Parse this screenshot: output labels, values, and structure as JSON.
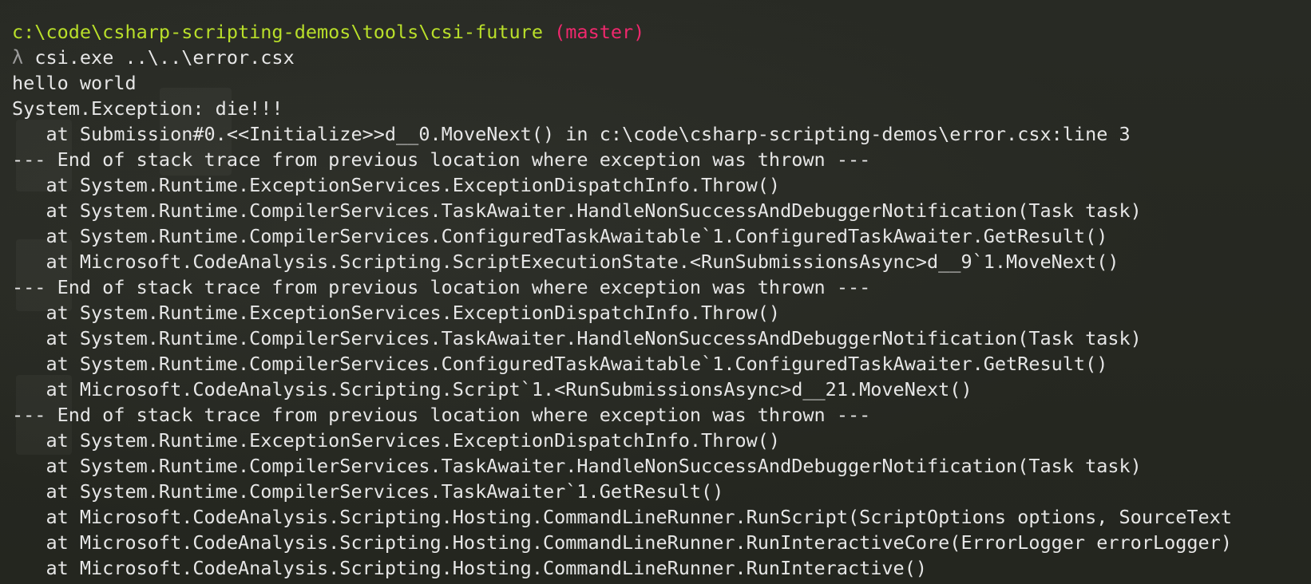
{
  "prompt": {
    "cwd": "c:\\code\\csharp-scripting-demos\\tools\\csi-future",
    "branch": "(master)",
    "symbol": "λ",
    "command": "csi.exe ..\\..\\error.csx"
  },
  "colors": {
    "background": "#262822",
    "text": "#e6e6e6",
    "path": "#b9df2a",
    "branch": "#f0286d",
    "lambda": "#9c9c9c"
  },
  "output": [
    "hello world",
    "System.Exception: die!!!",
    "   at Submission#0.<<Initialize>>d__0.MoveNext() in c:\\code\\csharp-scripting-demos\\error.csx:line 3",
    "--- End of stack trace from previous location where exception was thrown ---",
    "   at System.Runtime.ExceptionServices.ExceptionDispatchInfo.Throw()",
    "   at System.Runtime.CompilerServices.TaskAwaiter.HandleNonSuccessAndDebuggerNotification(Task task)",
    "   at System.Runtime.CompilerServices.ConfiguredTaskAwaitable`1.ConfiguredTaskAwaiter.GetResult()",
    "   at Microsoft.CodeAnalysis.Scripting.ScriptExecutionState.<RunSubmissionsAsync>d__9`1.MoveNext()",
    "--- End of stack trace from previous location where exception was thrown ---",
    "   at System.Runtime.ExceptionServices.ExceptionDispatchInfo.Throw()",
    "   at System.Runtime.CompilerServices.TaskAwaiter.HandleNonSuccessAndDebuggerNotification(Task task)",
    "   at System.Runtime.CompilerServices.ConfiguredTaskAwaitable`1.ConfiguredTaskAwaiter.GetResult()",
    "   at Microsoft.CodeAnalysis.Scripting.Script`1.<RunSubmissionsAsync>d__21.MoveNext()",
    "--- End of stack trace from previous location where exception was thrown ---",
    "   at System.Runtime.ExceptionServices.ExceptionDispatchInfo.Throw()",
    "   at System.Runtime.CompilerServices.TaskAwaiter.HandleNonSuccessAndDebuggerNotification(Task task)",
    "   at System.Runtime.CompilerServices.TaskAwaiter`1.GetResult()",
    "   at Microsoft.CodeAnalysis.Scripting.Hosting.CommandLineRunner.RunScript(ScriptOptions options, SourceText",
    "   at Microsoft.CodeAnalysis.Scripting.Hosting.CommandLineRunner.RunInteractiveCore(ErrorLogger errorLogger)",
    "   at Microsoft.CodeAnalysis.Scripting.Hosting.CommandLineRunner.RunInteractive()"
  ]
}
